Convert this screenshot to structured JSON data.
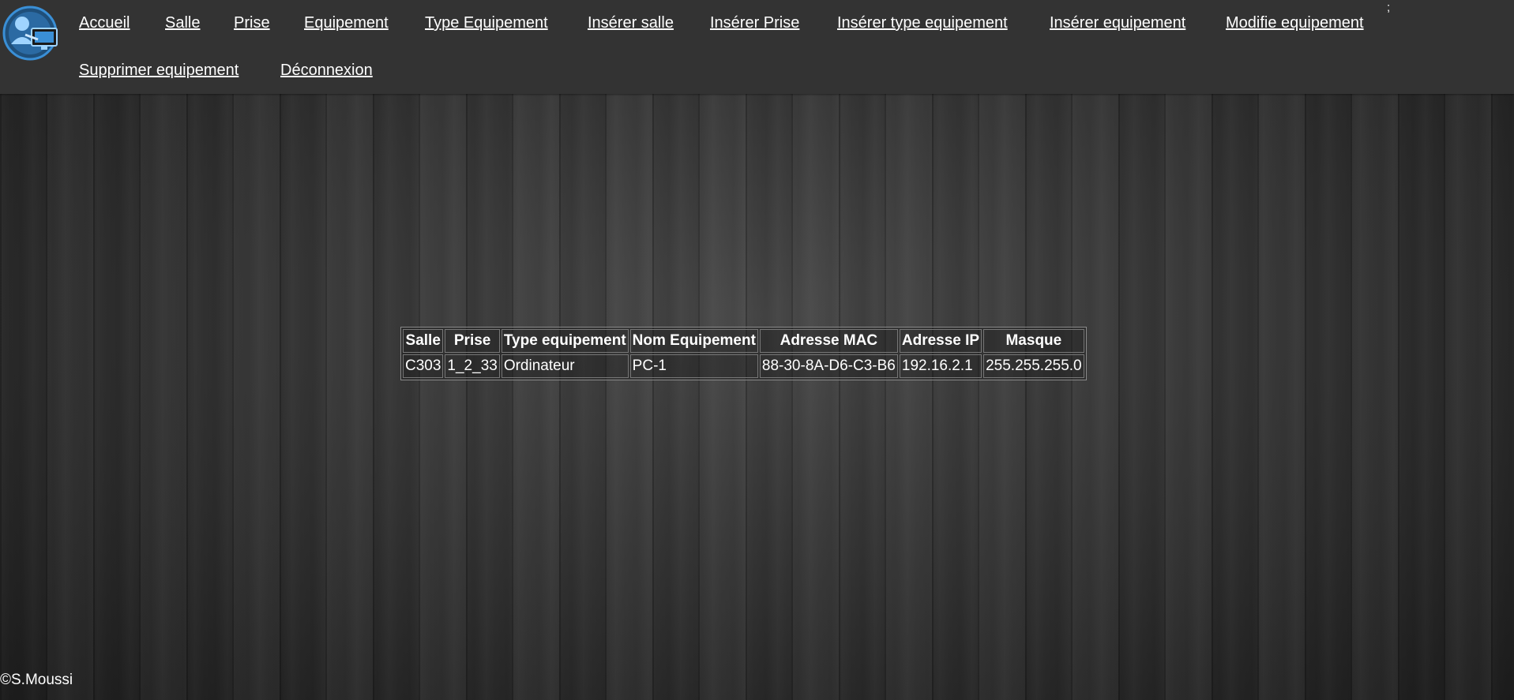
{
  "nav": {
    "links": [
      "Accueil",
      "Salle",
      "Prise",
      "Equipement",
      "Type Equipement",
      "Insérer salle",
      "Insérer Prise",
      "Insérer type equipement",
      "Insérer equipement",
      "Modifie equipement",
      "Supprimer equipement",
      "Déconnexion"
    ],
    "trailing_text": ";"
  },
  "table": {
    "headers": [
      "Salle",
      "Prise",
      "Type equipement",
      "Nom Equipement",
      "Adresse MAC",
      "Adresse IP",
      "Masque"
    ],
    "rows": [
      [
        "C303",
        "1_2_33",
        "Ordinateur",
        "PC-1",
        "88-30-8A-D6-C3-B6",
        "192.16.2.1",
        "255.255.255.0"
      ]
    ]
  },
  "footer": {
    "text": "©S.Moussi"
  },
  "colors": {
    "header_bg": "#333333",
    "text": "#ffffff",
    "logo_accent": "#3a8fd6"
  },
  "icons": {
    "logo": "network-admin-logo"
  }
}
